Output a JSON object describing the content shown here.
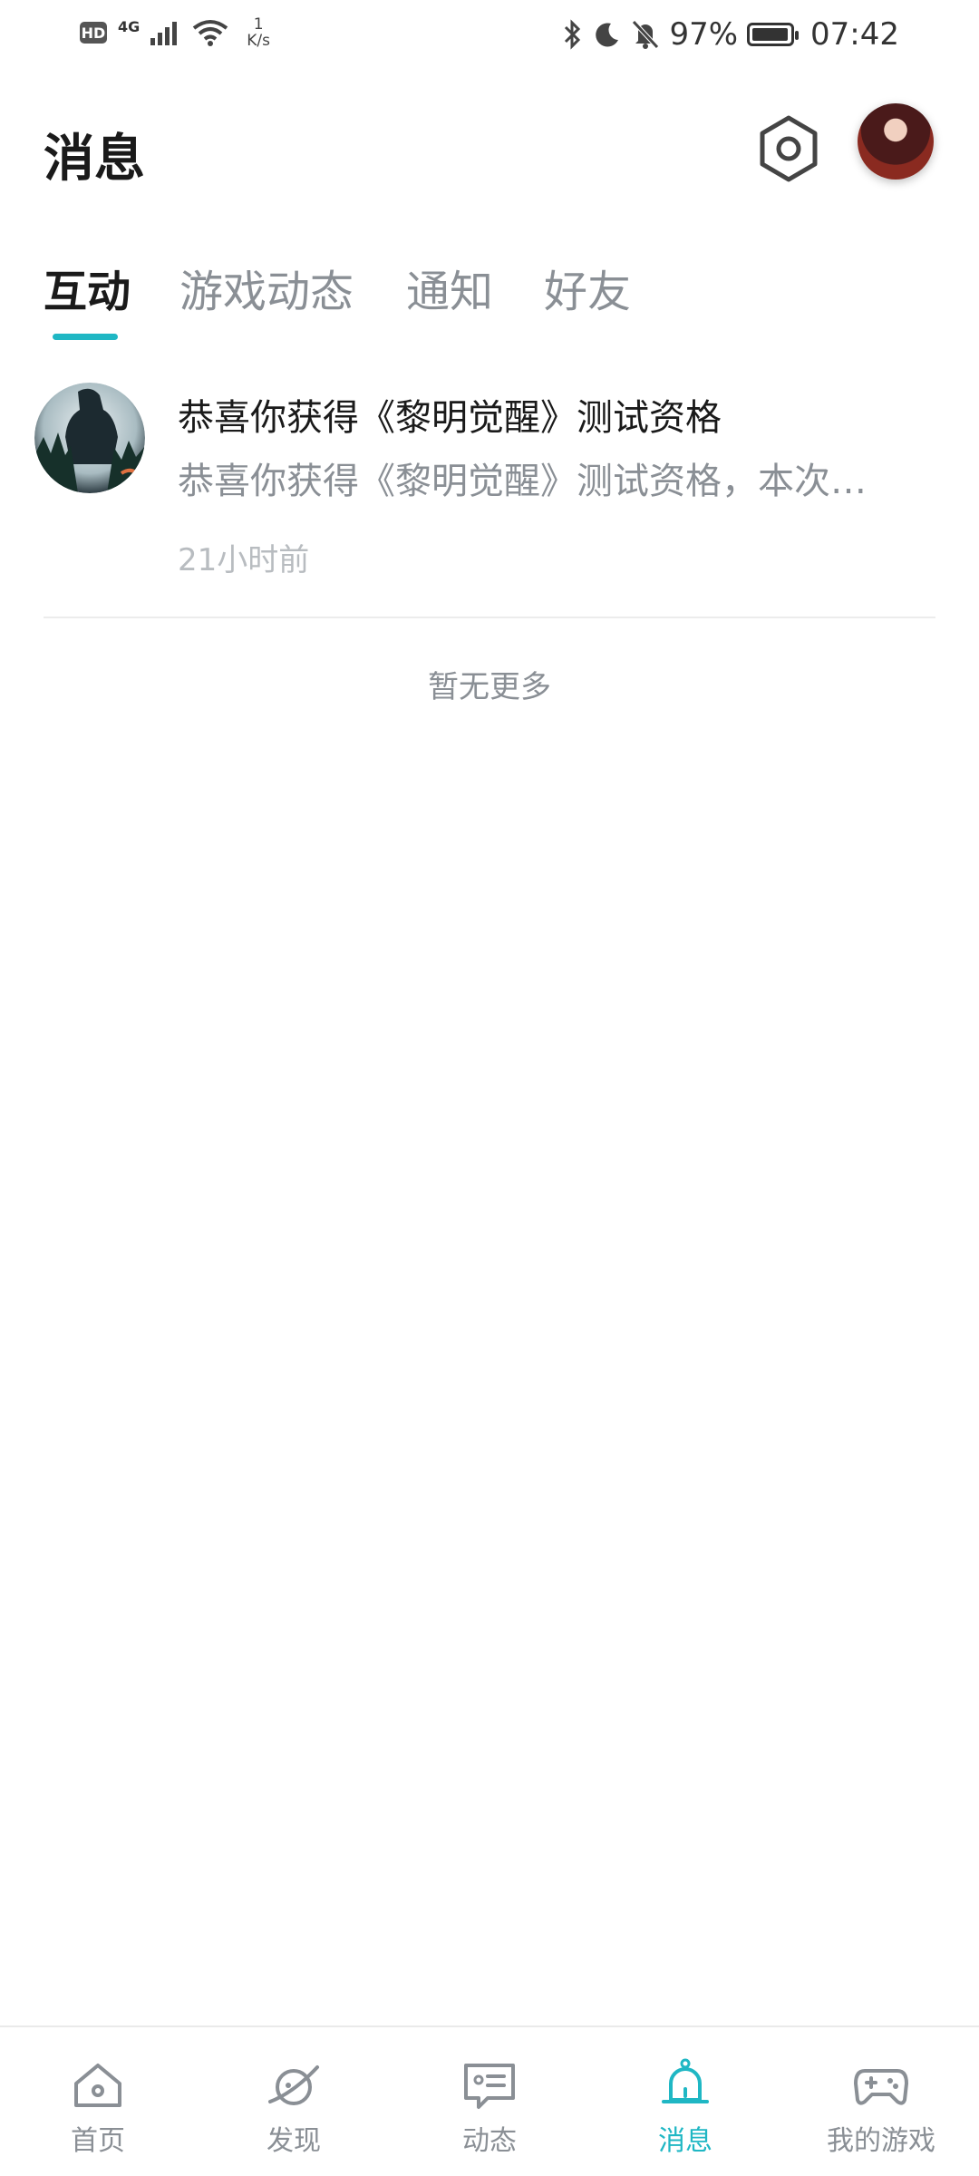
{
  "status_bar": {
    "hd": "HD",
    "network": "4G",
    "speed_value": "1",
    "speed_unit": "K/s",
    "battery_percent": "97%",
    "battery_level": 0.97,
    "time": "07:42"
  },
  "header": {
    "title": "消息"
  },
  "tabs": [
    {
      "label": "互动",
      "active": true
    },
    {
      "label": "游戏动态",
      "active": false
    },
    {
      "label": "通知",
      "active": false
    },
    {
      "label": "好友",
      "active": false
    }
  ],
  "messages": [
    {
      "title": "恭喜你获得《黎明觉醒》测试资格",
      "preview": "恭喜你获得《黎明觉醒》测试资格，本次…",
      "time": "21小时前"
    }
  ],
  "list_footer": "暂无更多",
  "bottom_nav": [
    {
      "label": "首页",
      "icon": "home-icon",
      "active": false
    },
    {
      "label": "发现",
      "icon": "planet-icon",
      "active": false
    },
    {
      "label": "动态",
      "icon": "chat-icon",
      "active": false
    },
    {
      "label": "消息",
      "icon": "bell-icon",
      "active": true
    },
    {
      "label": "我的游戏",
      "icon": "gamepad-icon",
      "active": false
    }
  ],
  "colors": {
    "accent": "#1fb7c4",
    "text_primary": "#1a1a1a",
    "text_secondary": "#8a8f95"
  }
}
